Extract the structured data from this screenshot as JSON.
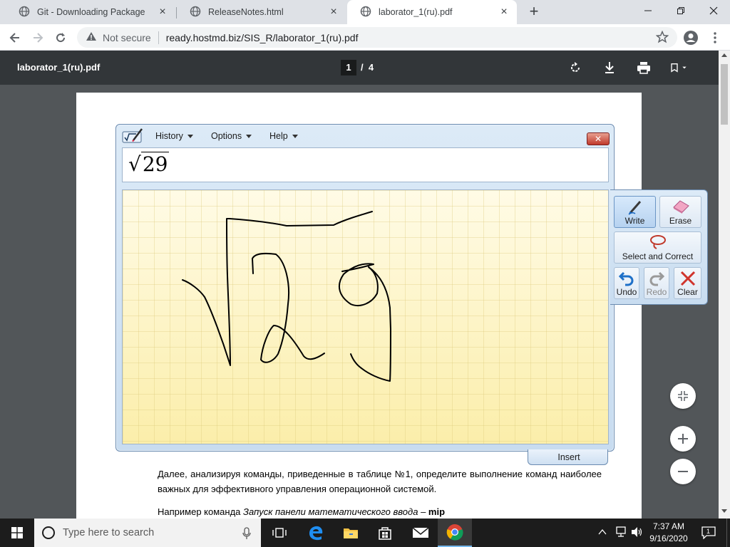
{
  "browser": {
    "tabs": [
      {
        "title": "Git - Downloading Package"
      },
      {
        "title": "ReleaseNotes.html"
      },
      {
        "title": "laborator_1(ru).pdf"
      }
    ],
    "security_label": "Not secure",
    "url": "ready.hostmd.biz/SIS_R/laborator_1(ru).pdf"
  },
  "pdf": {
    "title": "laborator_1(ru).pdf",
    "current_page": "1",
    "page_separator": "/",
    "total_pages": "4"
  },
  "math_panel": {
    "menu": [
      "History",
      "Options",
      "Help"
    ],
    "preview_radical": "√",
    "preview_value": "29",
    "insert_label": "Insert",
    "tools": {
      "write": "Write",
      "erase": "Erase",
      "select_correct": "Select and Correct",
      "undo": "Undo",
      "redo": "Redo",
      "clear": "Clear"
    }
  },
  "document": {
    "paragraph": "Далее, анализируя команды, приведенные в таблице №1, определите выполнение команд наиболее важных для эффективного управления операционной системой.",
    "example_prefix": "Например команда ",
    "example_italic": "Запуск панели математического ввода",
    "example_dash": " – ",
    "example_bold": "mip"
  },
  "taskbar": {
    "search_placeholder": "Type here to search",
    "time": "7:37 AM",
    "date": "9/16/2020",
    "notification_count": "1"
  },
  "colors": {
    "chrome_tabbar": "#dee1e6",
    "pdf_toolbar": "#323639",
    "pdf_background": "#525659",
    "ink_pad": "#fdf6c8",
    "taskbar": "#1c1c1c"
  }
}
